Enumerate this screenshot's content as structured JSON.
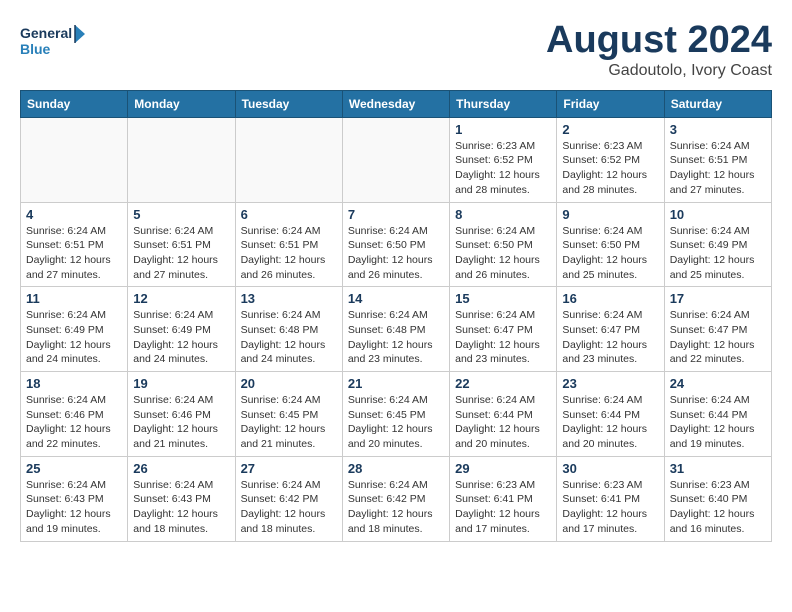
{
  "logo": {
    "line1": "General",
    "line2": "Blue"
  },
  "title": "August 2024",
  "subtitle": "Gadoutolo, Ivory Coast",
  "days_header": [
    "Sunday",
    "Monday",
    "Tuesday",
    "Wednesday",
    "Thursday",
    "Friday",
    "Saturday"
  ],
  "weeks": [
    [
      {
        "day": "",
        "info": ""
      },
      {
        "day": "",
        "info": ""
      },
      {
        "day": "",
        "info": ""
      },
      {
        "day": "",
        "info": ""
      },
      {
        "day": "1",
        "info": "Sunrise: 6:23 AM\nSunset: 6:52 PM\nDaylight: 12 hours\nand 28 minutes."
      },
      {
        "day": "2",
        "info": "Sunrise: 6:23 AM\nSunset: 6:52 PM\nDaylight: 12 hours\nand 28 minutes."
      },
      {
        "day": "3",
        "info": "Sunrise: 6:24 AM\nSunset: 6:51 PM\nDaylight: 12 hours\nand 27 minutes."
      }
    ],
    [
      {
        "day": "4",
        "info": "Sunrise: 6:24 AM\nSunset: 6:51 PM\nDaylight: 12 hours\nand 27 minutes."
      },
      {
        "day": "5",
        "info": "Sunrise: 6:24 AM\nSunset: 6:51 PM\nDaylight: 12 hours\nand 27 minutes."
      },
      {
        "day": "6",
        "info": "Sunrise: 6:24 AM\nSunset: 6:51 PM\nDaylight: 12 hours\nand 26 minutes."
      },
      {
        "day": "7",
        "info": "Sunrise: 6:24 AM\nSunset: 6:50 PM\nDaylight: 12 hours\nand 26 minutes."
      },
      {
        "day": "8",
        "info": "Sunrise: 6:24 AM\nSunset: 6:50 PM\nDaylight: 12 hours\nand 26 minutes."
      },
      {
        "day": "9",
        "info": "Sunrise: 6:24 AM\nSunset: 6:50 PM\nDaylight: 12 hours\nand 25 minutes."
      },
      {
        "day": "10",
        "info": "Sunrise: 6:24 AM\nSunset: 6:49 PM\nDaylight: 12 hours\nand 25 minutes."
      }
    ],
    [
      {
        "day": "11",
        "info": "Sunrise: 6:24 AM\nSunset: 6:49 PM\nDaylight: 12 hours\nand 24 minutes."
      },
      {
        "day": "12",
        "info": "Sunrise: 6:24 AM\nSunset: 6:49 PM\nDaylight: 12 hours\nand 24 minutes."
      },
      {
        "day": "13",
        "info": "Sunrise: 6:24 AM\nSunset: 6:48 PM\nDaylight: 12 hours\nand 24 minutes."
      },
      {
        "day": "14",
        "info": "Sunrise: 6:24 AM\nSunset: 6:48 PM\nDaylight: 12 hours\nand 23 minutes."
      },
      {
        "day": "15",
        "info": "Sunrise: 6:24 AM\nSunset: 6:47 PM\nDaylight: 12 hours\nand 23 minutes."
      },
      {
        "day": "16",
        "info": "Sunrise: 6:24 AM\nSunset: 6:47 PM\nDaylight: 12 hours\nand 23 minutes."
      },
      {
        "day": "17",
        "info": "Sunrise: 6:24 AM\nSunset: 6:47 PM\nDaylight: 12 hours\nand 22 minutes."
      }
    ],
    [
      {
        "day": "18",
        "info": "Sunrise: 6:24 AM\nSunset: 6:46 PM\nDaylight: 12 hours\nand 22 minutes."
      },
      {
        "day": "19",
        "info": "Sunrise: 6:24 AM\nSunset: 6:46 PM\nDaylight: 12 hours\nand 21 minutes."
      },
      {
        "day": "20",
        "info": "Sunrise: 6:24 AM\nSunset: 6:45 PM\nDaylight: 12 hours\nand 21 minutes."
      },
      {
        "day": "21",
        "info": "Sunrise: 6:24 AM\nSunset: 6:45 PM\nDaylight: 12 hours\nand 20 minutes."
      },
      {
        "day": "22",
        "info": "Sunrise: 6:24 AM\nSunset: 6:44 PM\nDaylight: 12 hours\nand 20 minutes."
      },
      {
        "day": "23",
        "info": "Sunrise: 6:24 AM\nSunset: 6:44 PM\nDaylight: 12 hours\nand 20 minutes."
      },
      {
        "day": "24",
        "info": "Sunrise: 6:24 AM\nSunset: 6:44 PM\nDaylight: 12 hours\nand 19 minutes."
      }
    ],
    [
      {
        "day": "25",
        "info": "Sunrise: 6:24 AM\nSunset: 6:43 PM\nDaylight: 12 hours\nand 19 minutes."
      },
      {
        "day": "26",
        "info": "Sunrise: 6:24 AM\nSunset: 6:43 PM\nDaylight: 12 hours\nand 18 minutes."
      },
      {
        "day": "27",
        "info": "Sunrise: 6:24 AM\nSunset: 6:42 PM\nDaylight: 12 hours\nand 18 minutes."
      },
      {
        "day": "28",
        "info": "Sunrise: 6:24 AM\nSunset: 6:42 PM\nDaylight: 12 hours\nand 18 minutes."
      },
      {
        "day": "29",
        "info": "Sunrise: 6:23 AM\nSunset: 6:41 PM\nDaylight: 12 hours\nand 17 minutes."
      },
      {
        "day": "30",
        "info": "Sunrise: 6:23 AM\nSunset: 6:41 PM\nDaylight: 12 hours\nand 17 minutes."
      },
      {
        "day": "31",
        "info": "Sunrise: 6:23 AM\nSunset: 6:40 PM\nDaylight: 12 hours\nand 16 minutes."
      }
    ]
  ]
}
